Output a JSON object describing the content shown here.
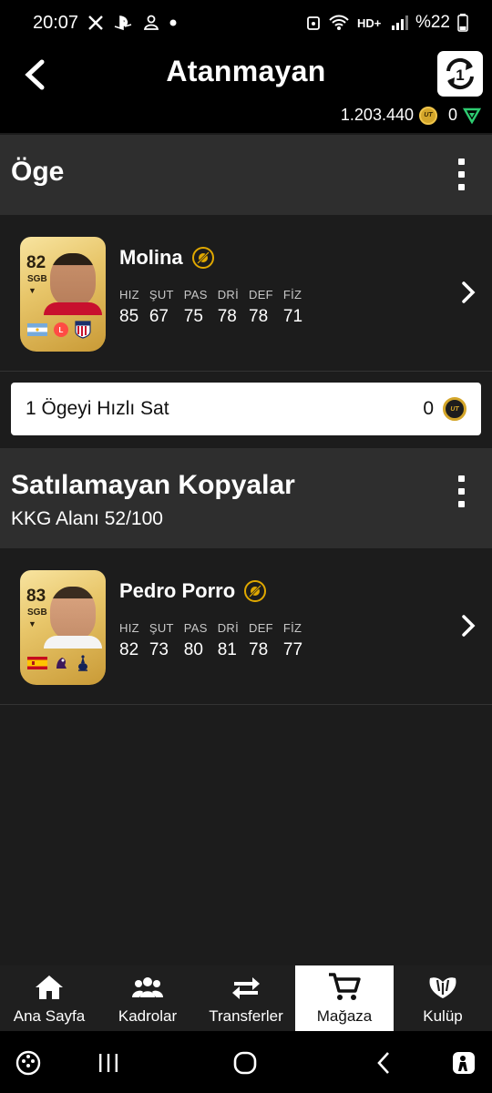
{
  "status_bar": {
    "time": "20:07",
    "battery": "%22"
  },
  "header": {
    "title": "Atanmayan",
    "coins": "1.203.440",
    "points": "0",
    "coin_logo": "UT"
  },
  "section_item": {
    "title": "Öge"
  },
  "players": [
    {
      "name": "Molina",
      "rating": "82",
      "position": "SGB",
      "stat_labels": [
        "HIZ",
        "ŞUT",
        "PAS",
        "DRİ",
        "DEF",
        "FİZ"
      ],
      "stat_values": [
        "85",
        "67",
        "75",
        "78",
        "78",
        "71"
      ],
      "nation": "argentina-flag",
      "league": "laliga-badge",
      "club": "atletico-madrid-badge"
    },
    {
      "name": "Pedro Porro",
      "rating": "83",
      "position": "SGB",
      "stat_labels": [
        "HIZ",
        "ŞUT",
        "PAS",
        "DRİ",
        "DEF",
        "FİZ"
      ],
      "stat_values": [
        "82",
        "73",
        "80",
        "81",
        "78",
        "77"
      ],
      "nation": "spain-flag",
      "league": "premier-league-badge",
      "club": "tottenham-badge"
    }
  ],
  "quick_sell": {
    "label": "1 Ögeyi Hızlı Sat",
    "value": "0"
  },
  "section_duplicates": {
    "title": "Satılamayan Kopyalar",
    "subtitle": "KKG Alanı 52/100"
  },
  "bottom_nav": [
    {
      "label": "Ana Sayfa",
      "icon": "home-icon",
      "active": false
    },
    {
      "label": "Kadrolar",
      "icon": "squad-icon",
      "active": false
    },
    {
      "label": "Transferler",
      "icon": "transfer-icon",
      "active": false
    },
    {
      "label": "Mağaza",
      "icon": "cart-icon",
      "active": true
    },
    {
      "label": "Kulüp",
      "icon": "club-icon",
      "active": false
    }
  ],
  "colors": {
    "background": "#1c1c1c",
    "header": "#000000",
    "section": "#2e2e2e",
    "gold": "#d4a62a",
    "untradeable": "#e0a800",
    "points": "#2ecc71"
  }
}
